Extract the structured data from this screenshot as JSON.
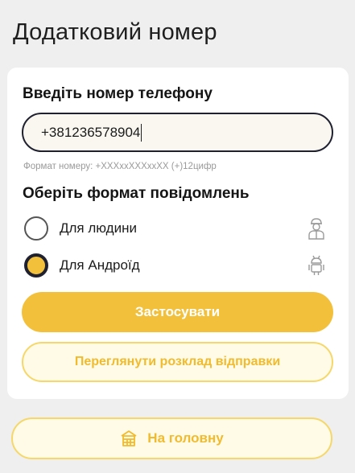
{
  "header": {
    "title": "Додатковий номер"
  },
  "form": {
    "phone_section_title": "Введіть номер телефону",
    "phone_value": "+381236578904",
    "format_hint": "Формат номеру: +XXXxxXXXxxXX (+)12цифр",
    "format_section_title": "Оберіть формат повідомлень",
    "options": [
      {
        "label": "Для людини",
        "selected": false,
        "icon": "person-icon"
      },
      {
        "label": "Для Андроїд",
        "selected": true,
        "icon": "android-icon"
      }
    ],
    "apply_label": "Застосувати",
    "schedule_label": "Переглянути розклад відправки"
  },
  "footer": {
    "home_label": "На головну",
    "home_icon": "home-icon"
  },
  "colors": {
    "accent": "#f2c03b",
    "accent_text": "#f0bb2e",
    "dark": "#1f2130",
    "background": "#efefef"
  }
}
